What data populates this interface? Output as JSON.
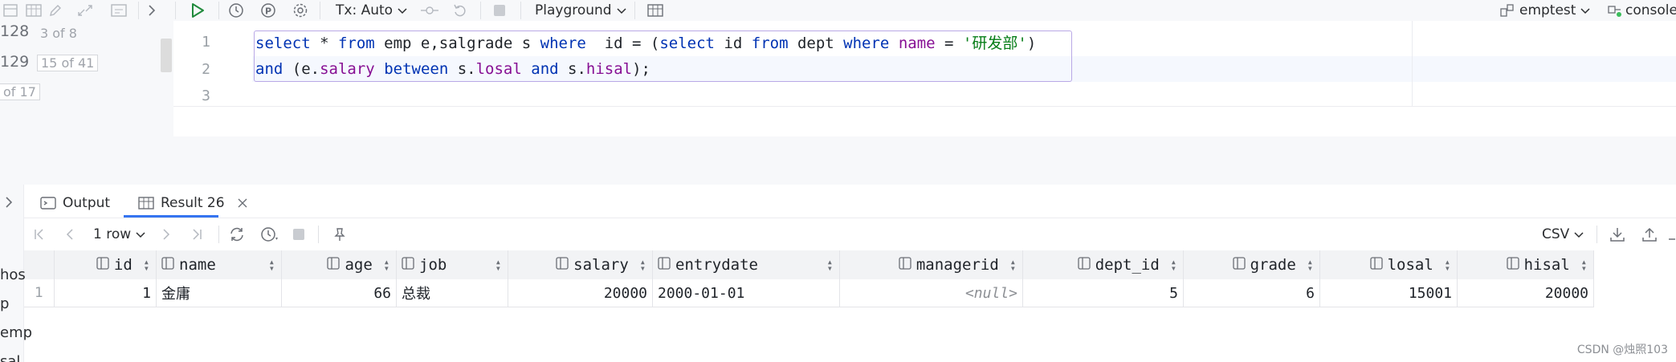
{
  "toolbar": {
    "tx_mode": "Tx: Auto",
    "playground": "Playground",
    "datasource": "emptest",
    "console": "console"
  },
  "left_strip": {
    "fragments": [
      "128",
      "3 of 8",
      "129",
      "15 of 41",
      "of 17"
    ]
  },
  "editor": {
    "line_numbers": [
      "1",
      "2",
      "3"
    ],
    "line1": {
      "t1": "select",
      "t2": " * ",
      "t3": "from",
      "t4": " emp e,salgrade s ",
      "t5": "where",
      "t6": "  id = (",
      "t7": "select",
      "t8": " id ",
      "t9": "from",
      "t10": " dept ",
      "t11": "where",
      "t12": " ",
      "t13": "name",
      "t14": " = ",
      "t15": "'研发部'",
      "t16": ")"
    },
    "line2": {
      "t1": "and",
      "t2": " (e.",
      "t3": "salary",
      "t4": " ",
      "t5": "between",
      "t6": " s.",
      "t7": "losal",
      "t8": " ",
      "t9": "and",
      "t10": " s.",
      "t11": "hisal",
      "t12": ");"
    }
  },
  "results": {
    "tabs": [
      {
        "label": "Output"
      },
      {
        "label": "Result 26"
      }
    ],
    "row_count": "1 row",
    "export_format": "CSV",
    "columns": [
      "id",
      "name",
      "age",
      "job",
      "salary",
      "entrydate",
      "managerid",
      "dept_id",
      "grade",
      "losal",
      "hisal"
    ],
    "rows": [
      {
        "row_no": "1",
        "id": "1",
        "name": "金庸",
        "age": "66",
        "job": "总裁",
        "salary": "20000",
        "entrydate": "2000-01-01",
        "managerid": "<null>",
        "dept_id": "5",
        "grade": "6",
        "losal": "15001",
        "hisal": "20000"
      }
    ]
  },
  "left_tree_fragments": [
    "hos",
    "p",
    "emp",
    "sal"
  ],
  "watermark": "CSDN @烛照103",
  "colors": {
    "keyword": "#0033b3",
    "field": "#871094",
    "string": "#067d17",
    "accent": "#3574f0",
    "run": "#208a3c"
  }
}
